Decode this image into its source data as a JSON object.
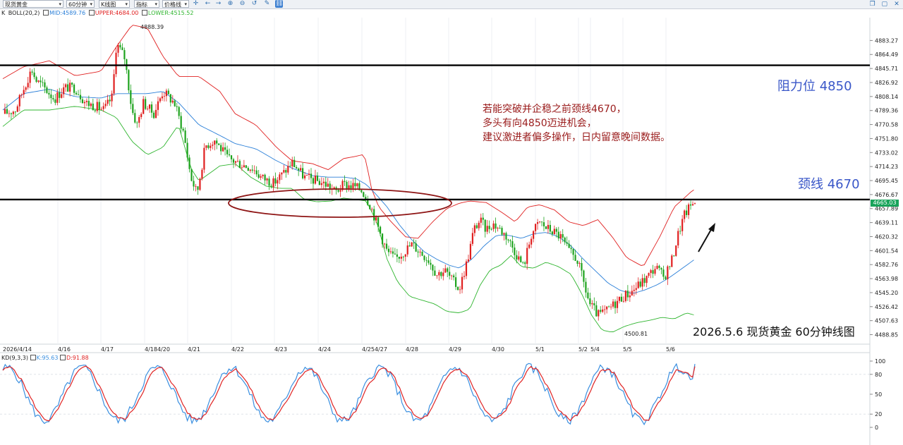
{
  "toolbar": {
    "symbol": "现货黄金",
    "period": "60分钟",
    "chart_style": "K线图",
    "indicator": "指标",
    "price_mode": "价格线"
  },
  "legend": {
    "k_label": "K",
    "boll_name": "BOLL(20,2)",
    "mid": "MID:4589.76",
    "upper": "UPPER:4684.00",
    "lower": "LOWER:4515.52",
    "kd_name": "KD(9,3,3)",
    "kd_k": "K:95.63",
    "kd_d": "D:91.88"
  },
  "colors": {
    "upper": "#e02020",
    "mid": "#2a7fd8",
    "lower": "#2fb52f",
    "up_candle": "#e02020",
    "down_candle": "#1ea31e",
    "kd_k": "#3a8fe0",
    "kd_d": "#e02424",
    "annotation_blue": "#3a57c8",
    "annotation_red": "#9a1b1b"
  },
  "annotations": {
    "resistance": "阻力位 4850",
    "neckline": "颈线 4670",
    "note_lines": [
      "若能突破并企稳之前颈线4670，",
      "多头有向4850迈进机会，",
      "建议激进者偏多操作，日内留意晚间数据。"
    ],
    "caption": "2026.5.6 现货黄金 60分钟线图",
    "high_label": "4888.39",
    "low_label": "4500.81",
    "last_price": "4665.03"
  },
  "chart_data": [
    {
      "type": "candlestick",
      "title": "",
      "instrument": "现货黄金",
      "timeframe": "60分钟",
      "x_dates": [
        "2026/4/14",
        "4/16",
        "4/17",
        "4/18",
        "4/20",
        "4/21",
        "4/22",
        "4/23",
        "4/24",
        "4/25",
        "4/27",
        "4/28",
        "4/29",
        "4/30",
        "5/1",
        "5/2",
        "5/4",
        "5/5",
        "5/6"
      ],
      "x_labels": [
        "2026/4/14",
        "4/16",
        "4/17",
        "4/184/20",
        "4/21",
        "4/22",
        "4/23",
        "4/24",
        "4/254/27",
        "4/28",
        "4/29",
        "4/30",
        "5/1",
        "5/2",
        "5/4",
        "5/5",
        "5/6"
      ],
      "y_ticks": [
        4883.27,
        4864.49,
        4845.71,
        4826.92,
        4808.14,
        4789.36,
        4770.58,
        4751.8,
        4733.02,
        4714.23,
        4695.45,
        4676.67,
        4657.89,
        4639.11,
        4620.32,
        4601.54,
        4582.76,
        4563.98,
        4545.2,
        4526.42,
        4507.63,
        4488.85
      ],
      "ylim": [
        4478,
        4912
      ],
      "horizontal_lines": [
        4850,
        4670
      ],
      "high": 4888.39,
      "low": 4500.81,
      "last": 4665.03,
      "bollinger_last": {
        "mid": 4589.76,
        "upper": 4684.0,
        "lower": 4515.52
      },
      "close_path": [
        [
          0,
          4785
        ],
        [
          12,
          4790
        ],
        [
          22,
          4825
        ],
        [
          28,
          4845
        ],
        [
          32,
          4830
        ],
        [
          40,
          4820
        ],
        [
          50,
          4805
        ],
        [
          60,
          4820
        ],
        [
          70,
          4820
        ],
        [
          80,
          4800
        ],
        [
          90,
          4795
        ],
        [
          98,
          4790
        ],
        [
          106,
          4808
        ],
        [
          110,
          4880
        ],
        [
          118,
          4860
        ],
        [
          125,
          4790
        ],
        [
          130,
          4770
        ],
        [
          136,
          4800
        ],
        [
          146,
          4785
        ],
        [
          155,
          4815
        ],
        [
          166,
          4800
        ],
        [
          175,
          4760
        ],
        [
          182,
          4700
        ],
        [
          188,
          4678
        ],
        [
          196,
          4742
        ],
        [
          205,
          4750
        ],
        [
          218,
          4725
        ],
        [
          230,
          4718
        ],
        [
          242,
          4712
        ],
        [
          250,
          4700
        ],
        [
          262,
          4692
        ],
        [
          272,
          4706
        ],
        [
          280,
          4720
        ],
        [
          292,
          4700
        ],
        [
          304,
          4695
        ],
        [
          314,
          4690
        ],
        [
          322,
          4680
        ],
        [
          330,
          4690
        ],
        [
          340,
          4688
        ],
        [
          348,
          4682
        ],
        [
          356,
          4662
        ],
        [
          364,
          4630
        ],
        [
          372,
          4600
        ],
        [
          380,
          4590
        ],
        [
          388,
          4600
        ],
        [
          396,
          4610
        ],
        [
          404,
          4600
        ],
        [
          412,
          4590
        ],
        [
          420,
          4570
        ],
        [
          428,
          4575
        ],
        [
          436,
          4560
        ],
        [
          442,
          4550
        ],
        [
          450,
          4590
        ],
        [
          456,
          4630
        ],
        [
          462,
          4642
        ],
        [
          468,
          4630
        ],
        [
          474,
          4638
        ],
        [
          480,
          4632
        ],
        [
          488,
          4620
        ],
        [
          496,
          4600
        ],
        [
          504,
          4580
        ],
        [
          512,
          4625
        ],
        [
          520,
          4640
        ],
        [
          526,
          4632
        ],
        [
          532,
          4628
        ],
        [
          540,
          4620
        ],
        [
          548,
          4600
        ],
        [
          556,
          4590
        ],
        [
          562,
          4560
        ],
        [
          568,
          4530
        ],
        [
          576,
          4515
        ],
        [
          584,
          4520
        ],
        [
          592,
          4530
        ],
        [
          600,
          4540
        ],
        [
          608,
          4546
        ],
        [
          616,
          4556
        ],
        [
          624,
          4566
        ],
        [
          632,
          4580
        ],
        [
          640,
          4565
        ],
        [
          648,
          4590
        ],
        [
          654,
          4625
        ],
        [
          660,
          4650
        ],
        [
          666,
          4662
        ],
        [
          670,
          4668
        ]
      ],
      "upper_band": [
        [
          0,
          4832
        ],
        [
          20,
          4848
        ],
        [
          45,
          4856
        ],
        [
          70,
          4836
        ],
        [
          95,
          4842
        ],
        [
          110,
          4875
        ],
        [
          125,
          4904
        ],
        [
          140,
          4900
        ],
        [
          155,
          4862
        ],
        [
          170,
          4835
        ],
        [
          190,
          4835
        ],
        [
          210,
          4815
        ],
        [
          225,
          4785
        ],
        [
          245,
          4770
        ],
        [
          265,
          4740
        ],
        [
          280,
          4722
        ],
        [
          300,
          4718
        ],
        [
          315,
          4710
        ],
        [
          330,
          4725
        ],
        [
          342,
          4728
        ],
        [
          348,
          4730
        ],
        [
          352,
          4722
        ],
        [
          356,
          4688
        ],
        [
          364,
          4660
        ],
        [
          376,
          4640
        ],
        [
          390,
          4620
        ],
        [
          402,
          4618
        ],
        [
          416,
          4640
        ],
        [
          430,
          4658
        ],
        [
          442,
          4665
        ],
        [
          452,
          4668
        ],
        [
          468,
          4666
        ],
        [
          484,
          4652
        ],
        [
          496,
          4640
        ],
        [
          508,
          4660
        ],
        [
          520,
          4663
        ],
        [
          534,
          4656
        ],
        [
          548,
          4640
        ],
        [
          562,
          4635
        ],
        [
          576,
          4643
        ],
        [
          590,
          4620
        ],
        [
          604,
          4592
        ],
        [
          620,
          4580
        ],
        [
          636,
          4620
        ],
        [
          650,
          4660
        ],
        [
          666,
          4680
        ],
        [
          670,
          4684
        ]
      ],
      "mid_band": [
        [
          0,
          4790
        ],
        [
          20,
          4812
        ],
        [
          45,
          4818
        ],
        [
          70,
          4808
        ],
        [
          95,
          4806
        ],
        [
          110,
          4812
        ],
        [
          125,
          4812
        ],
        [
          140,
          4812
        ],
        [
          155,
          4815
        ],
        [
          170,
          4800
        ],
        [
          190,
          4770
        ],
        [
          210,
          4756
        ],
        [
          225,
          4745
        ],
        [
          245,
          4738
        ],
        [
          265,
          4722
        ],
        [
          280,
          4712
        ],
        [
          300,
          4702
        ],
        [
          315,
          4700
        ],
        [
          330,
          4700
        ],
        [
          342,
          4698
        ],
        [
          352,
          4690
        ],
        [
          362,
          4676
        ],
        [
          372,
          4660
        ],
        [
          384,
          4636
        ],
        [
          396,
          4616
        ],
        [
          408,
          4600
        ],
        [
          420,
          4590
        ],
        [
          432,
          4582
        ],
        [
          442,
          4578
        ],
        [
          454,
          4590
        ],
        [
          466,
          4608
        ],
        [
          478,
          4622
        ],
        [
          490,
          4622
        ],
        [
          502,
          4618
        ],
        [
          514,
          4624
        ],
        [
          526,
          4626
        ],
        [
          538,
          4620
        ],
        [
          550,
          4608
        ],
        [
          562,
          4590
        ],
        [
          574,
          4574
        ],
        [
          586,
          4558
        ],
        [
          598,
          4548
        ],
        [
          610,
          4544
        ],
        [
          622,
          4549
        ],
        [
          634,
          4556
        ],
        [
          646,
          4566
        ],
        [
          658,
          4578
        ],
        [
          670,
          4590
        ]
      ],
      "lower_band": [
        [
          0,
          4768
        ],
        [
          20,
          4790
        ],
        [
          45,
          4790
        ],
        [
          70,
          4795
        ],
        [
          95,
          4790
        ],
        [
          110,
          4780
        ],
        [
          125,
          4748
        ],
        [
          140,
          4730
        ],
        [
          155,
          4740
        ],
        [
          170,
          4770
        ],
        [
          182,
          4712
        ],
        [
          190,
          4695
        ],
        [
          210,
          4715
        ],
        [
          225,
          4718
        ],
        [
          240,
          4700
        ],
        [
          255,
          4688
        ],
        [
          268,
          4685
        ],
        [
          280,
          4685
        ],
        [
          292,
          4670
        ],
        [
          304,
          4667
        ],
        [
          318,
          4668
        ],
        [
          330,
          4672
        ],
        [
          342,
          4670
        ],
        [
          352,
          4668
        ],
        [
          362,
          4640
        ],
        [
          372,
          4590
        ],
        [
          382,
          4560
        ],
        [
          394,
          4540
        ],
        [
          406,
          4535
        ],
        [
          418,
          4530
        ],
        [
          430,
          4520
        ],
        [
          442,
          4518
        ],
        [
          452,
          4523
        ],
        [
          462,
          4555
        ],
        [
          472,
          4576
        ],
        [
          482,
          4582
        ],
        [
          492,
          4595
        ],
        [
          502,
          4580
        ],
        [
          514,
          4578
        ],
        [
          526,
          4586
        ],
        [
          538,
          4580
        ],
        [
          550,
          4570
        ],
        [
          560,
          4545
        ],
        [
          570,
          4515
        ],
        [
          580,
          4495
        ],
        [
          590,
          4492
        ],
        [
          602,
          4500
        ],
        [
          614,
          4505
        ],
        [
          626,
          4508
        ],
        [
          638,
          4512
        ],
        [
          650,
          4510
        ],
        [
          662,
          4518
        ],
        [
          670,
          4515
        ]
      ]
    },
    {
      "type": "line",
      "title": "",
      "indicator": "KD(9,3,3)",
      "y_ticks": [
        100,
        80,
        50,
        20,
        0
      ],
      "ylim": [
        0,
        100
      ],
      "series": [
        {
          "name": "K",
          "last": 95.63
        },
        {
          "name": "D",
          "last": 91.88
        }
      ]
    }
  ]
}
